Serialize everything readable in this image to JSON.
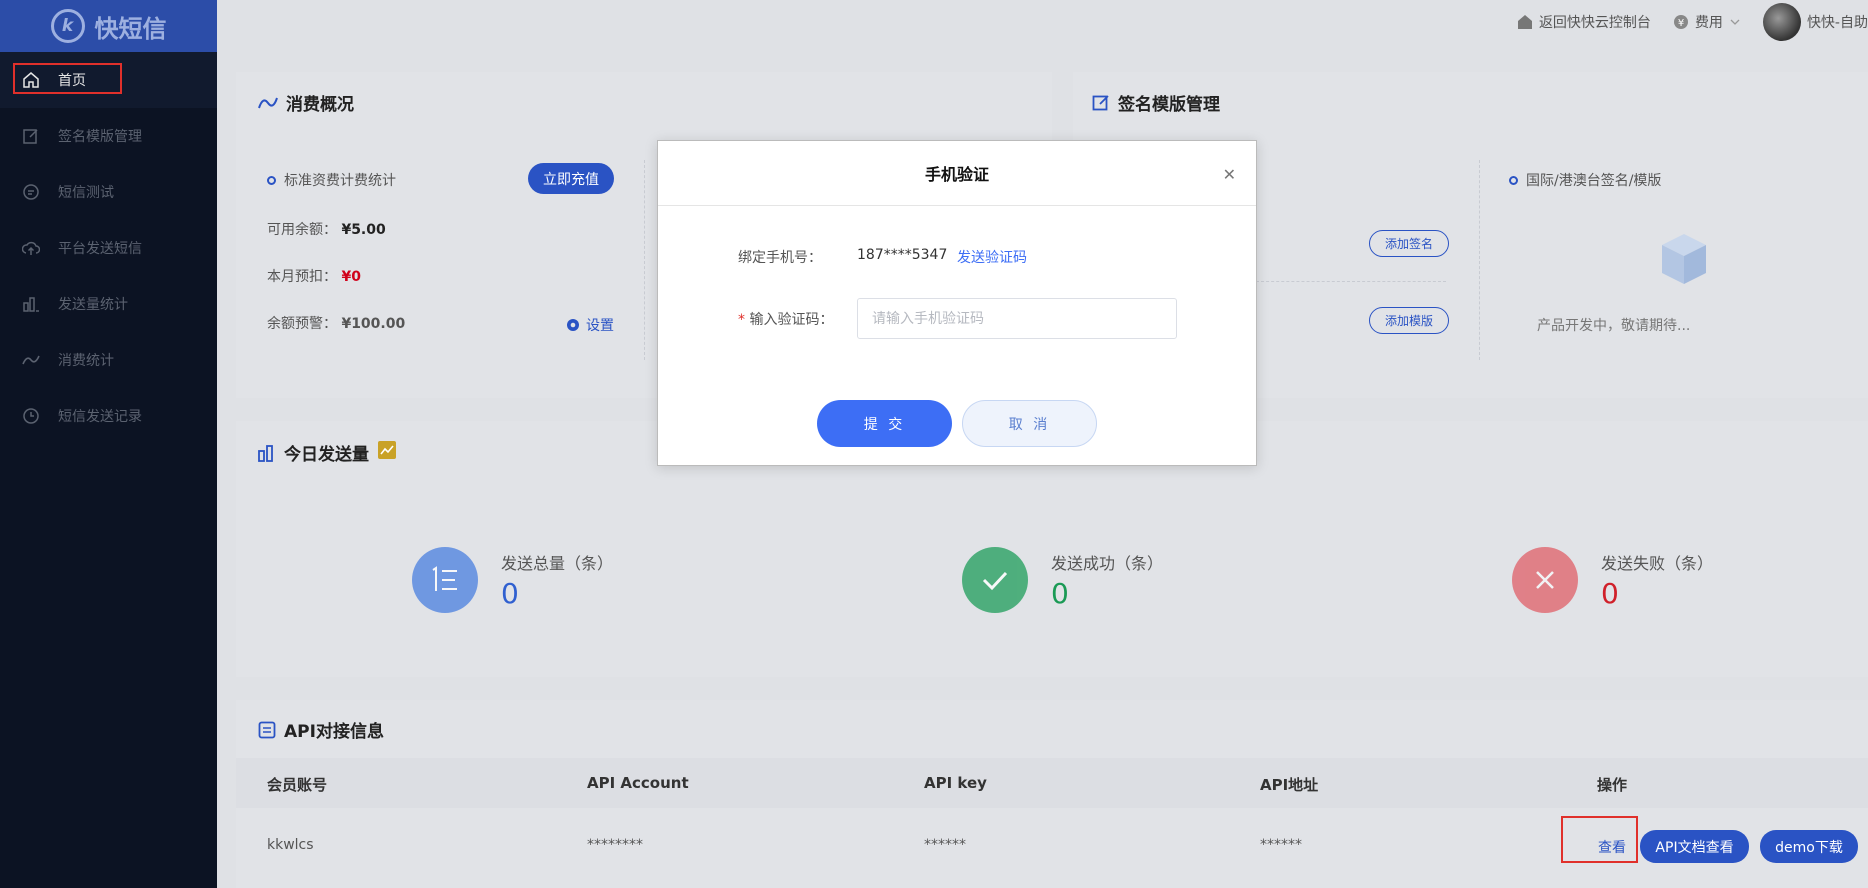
{
  "brand": {
    "name": "快短信",
    "logo_glyph": "k"
  },
  "sidebar": {
    "items": [
      {
        "label": "首页",
        "icon": "home-icon",
        "active": true
      },
      {
        "label": "签名模版管理",
        "icon": "edit-icon"
      },
      {
        "label": "短信测试",
        "icon": "message-icon"
      },
      {
        "label": "平台发送短信",
        "icon": "cloud-upload-icon"
      },
      {
        "label": "发送量统计",
        "icon": "bar-chart-icon"
      },
      {
        "label": "消费统计",
        "icon": "trend-icon"
      },
      {
        "label": "短信发送记录",
        "icon": "clock-icon"
      }
    ]
  },
  "topbar": {
    "console_link": "返回快快云控制台",
    "fees_label": "费用",
    "user_name": "快快-自助"
  },
  "consumption": {
    "title": "消费概况",
    "stats_label": "标准资费计费统计",
    "recharge_button": "立即充值",
    "balance_label": "可用余额：",
    "balance_value": "¥5.00",
    "month_label": "本月预扣：",
    "month_value": "¥0",
    "warning_label": "余额预警：",
    "warning_value": "¥100.00",
    "settings_label": "设置"
  },
  "signature": {
    "title": "签名模版管理",
    "add_signature": "添加签名",
    "add_template": "添加模版",
    "intl_label": "国际/港澳台签名/模版",
    "developing": "产品开发中，敬请期待..."
  },
  "today": {
    "title": "今日发送量",
    "total_label": "发送总量（条）",
    "total_value": "0",
    "success_label": "发送成功（条）",
    "success_value": "0",
    "fail_label": "发送失败（条）",
    "fail_value": "0",
    "colors": {
      "total": "#4a7fe0",
      "success": "#1e9d5a",
      "fail": "#e0303a"
    }
  },
  "api": {
    "title": "API对接信息",
    "columns": [
      "会员账号",
      "API Account",
      "API key",
      "API地址",
      "操作"
    ],
    "row": {
      "account": "kkwlcs",
      "api_account": "********",
      "api_key": "******",
      "api_url": "******"
    },
    "view_link": "查看",
    "doc_button": "API文档查看",
    "demo_button": "demo下载"
  },
  "modal": {
    "title": "手机验证",
    "phone_label": "绑定手机号：",
    "phone_value": "187****5347",
    "send_code": "发送验证码",
    "required_mark": "*",
    "code_label": "输入验证码：",
    "code_placeholder": "请输入手机验证码",
    "code_value": "",
    "submit": "提 交",
    "cancel": "取 消"
  },
  "colors": {
    "accent": "#3d6ef5",
    "sidebar_bg": "#0c1323",
    "logo_bg": "#2c4da8",
    "highlight": "#e0302b"
  }
}
